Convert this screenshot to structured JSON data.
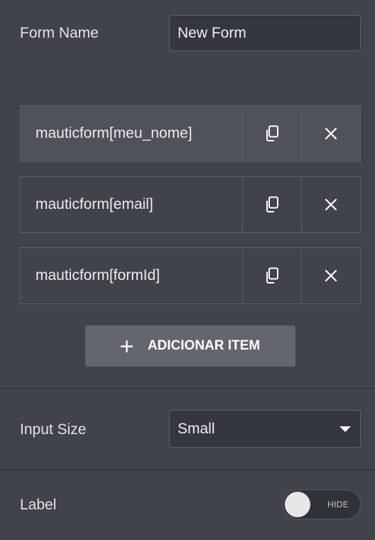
{
  "form_name": {
    "label": "Form Name",
    "value": "New Form"
  },
  "items": [
    {
      "title": "mauticform[meu_nome]",
      "active": true
    },
    {
      "title": "mauticform[email]",
      "active": false
    },
    {
      "title": "mauticform[formId]",
      "active": false
    }
  ],
  "add_button": {
    "icon": "plus-icon",
    "label": "ADICIONAR ITEM"
  },
  "input_size": {
    "label": "Input Size",
    "value": "Small"
  },
  "label_toggle": {
    "label": "Label",
    "state_text": "HIDE",
    "on": false
  },
  "colors": {
    "panel_bg": "#404349",
    "input_bg": "#34373d",
    "active_item_bg": "#4f5258",
    "button_bg": "#63666c",
    "text": "#e3e4e6"
  }
}
